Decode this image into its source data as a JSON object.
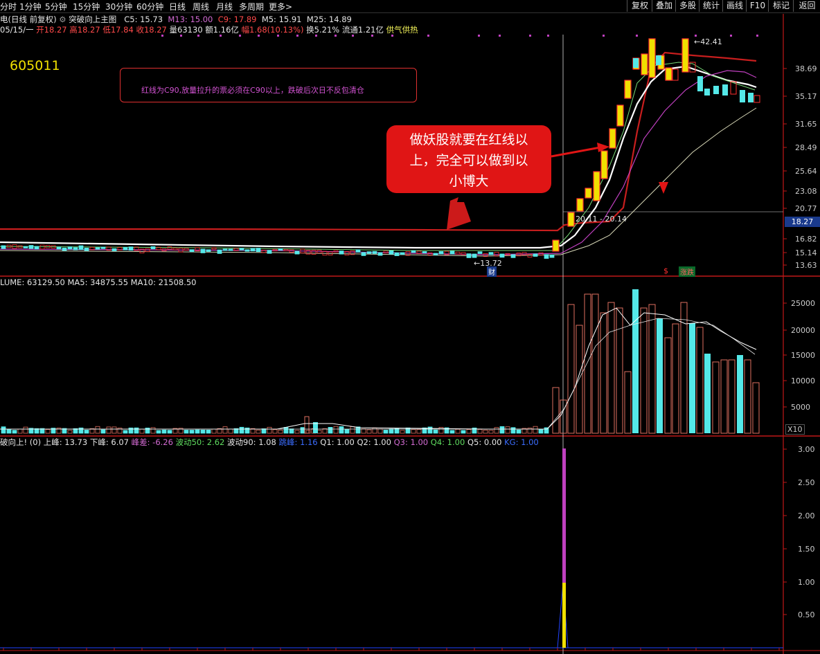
{
  "toolbar": {
    "periods": [
      "分时",
      "1分钟",
      "5分钟",
      "15分钟",
      "30分钟",
      "60分钟",
      "日线",
      "周线",
      "月线",
      "多周期",
      "更多>"
    ],
    "buttons": [
      "复权",
      "叠加",
      "多股",
      "统计",
      "画线",
      "F10",
      "标记",
      "返回"
    ]
  },
  "header": {
    "title": "电(日线 前复权)",
    "indicator_name": "突破向上主图",
    "c5": "C5: 15.73",
    "m13": "M13: 15.00",
    "c9": "C9: 17.89",
    "m5": "M5: 15.91",
    "m25": "M25: 14.89"
  },
  "quote": {
    "date": "05/15/一",
    "open": "开18.27",
    "high": "高18.27",
    "low": "低17.84",
    "close": "收18.27",
    "volume": "量63130",
    "amount": "额1.16亿",
    "change": "幅1.68(10.13%)",
    "turnover": "换5.21%",
    "float": "流通1.21亿",
    "tag": "供气供热"
  },
  "stock_code": "605011",
  "note": "红线为C90,放量拉升的票必须在C90以上，跌破后次日不反包清仓",
  "bubble_lines": [
    "做妖股就要在红线以",
    "上，完全可以做到以",
    "小博大"
  ],
  "price_axis": [
    "38.69",
    "35.17",
    "31.65",
    "28.49",
    "25.64",
    "23.08",
    "20.77",
    "16.82",
    "15.14",
    "13.63"
  ],
  "price_flag": "18.27",
  "annotations": {
    "high_label": "42.41",
    "low_label": "13.72",
    "range_label": "20.11 - 20.14",
    "cai_badge": "财",
    "s_badge": "$",
    "zhangdie_badge": "涨跌"
  },
  "volume_header": {
    "label": "LUME: 63129.50",
    "ma5": "MA5: 34875.55",
    "ma10": "MA10: 21508.50"
  },
  "volume_axis": [
    "25000",
    "20000",
    "15000",
    "10000",
    "5000"
  ],
  "volume_unit": "X10",
  "lower_header": {
    "name": "破向上!",
    "param": "(0)",
    "up_peak": "上峰: 13.73",
    "down_peak": "下峰: 6.07",
    "peak_diff": "峰差: -6.26",
    "wave50": "波动50: 2.62",
    "wave90": "波动90: 1.08",
    "new_peak": "跳峰: 1.16",
    "q1": "Q1: 1.00",
    "q2": "Q2: 1.00",
    "q3": "Q3: 1.00",
    "q4": "Q4: 1.00",
    "q5": "Q5: 0.00",
    "kg": "KG: 1.00"
  },
  "lower_axis": [
    "3.00",
    "2.50",
    "2.00",
    "1.50",
    "1.00",
    "0.50"
  ],
  "colors": {
    "up_candle": "#ff3030",
    "down_candle": "#54e8e8",
    "c90_line": "#c81e1e",
    "accent_yellow": "#f0e000",
    "bubble": "#e01515"
  }
}
